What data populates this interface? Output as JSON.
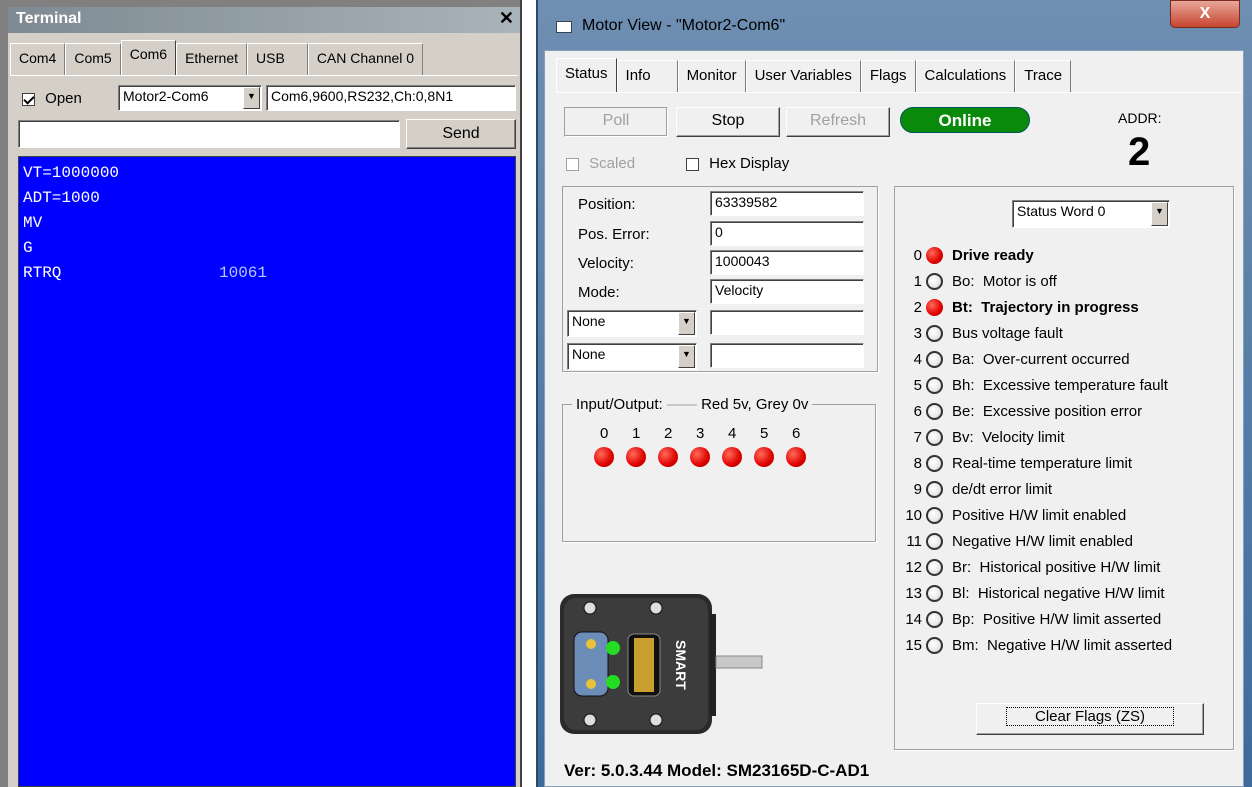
{
  "terminal": {
    "title": "Terminal",
    "close_glyph": "✕",
    "tabs": [
      "Com4",
      "Com5",
      "Com6",
      "Ethernet",
      "USB",
      "CAN Channel 0"
    ],
    "active_tab": "Com6",
    "open_label": "Open",
    "open_checked": true,
    "motor_select": "Motor2-Com6",
    "port_settings": "Com6,9600,RS232,Ch:0,8N1",
    "command_input": "",
    "send_label": "Send",
    "console_lines": [
      {
        "text": "VT=1000000",
        "value": ""
      },
      {
        "text": "ADT=1000",
        "value": ""
      },
      {
        "text": "MV",
        "value": ""
      },
      {
        "text": "G",
        "value": ""
      },
      {
        "text": "RTRQ",
        "value": "10061"
      }
    ]
  },
  "motor_view": {
    "title": "Motor View - \"Motor2-Com6\"",
    "close_glyph": "X",
    "tabs": [
      "Status",
      "Info",
      "Monitor",
      "User Variables",
      "Flags",
      "Calculations",
      "Trace"
    ],
    "active_tab": "Status",
    "buttons": {
      "poll": "Poll",
      "stop": "Stop",
      "refresh": "Refresh"
    },
    "online_label": "Online",
    "addr_label": "ADDR:",
    "addr_value": "2",
    "scaled_label": "Scaled",
    "hex_display_label": "Hex Display",
    "fields": [
      {
        "label": "Position:",
        "value": "63339582"
      },
      {
        "label": "Pos. Error:",
        "value": "0"
      },
      {
        "label": "Velocity:",
        "value": "1000043"
      },
      {
        "label": "Mode:",
        "value": "Velocity"
      }
    ],
    "extra_selects": [
      {
        "option": "None",
        "value": ""
      },
      {
        "option": "None",
        "value": ""
      }
    ],
    "io": {
      "title": "Input/Output:",
      "legend": "Red 5v, Grey 0v",
      "pins": [
        "0",
        "1",
        "2",
        "3",
        "4",
        "5",
        "6"
      ],
      "states": [
        "on",
        "on",
        "on",
        "on",
        "on",
        "on",
        "on"
      ]
    },
    "status_word_select": "Status Word 0",
    "status_bits": [
      {
        "idx": "0",
        "text": "Drive ready",
        "on": true,
        "bold": true
      },
      {
        "idx": "1",
        "text": "Bo:  Motor is off",
        "on": false,
        "bold": false
      },
      {
        "idx": "2",
        "text": "Bt:  Trajectory in progress",
        "on": true,
        "bold": true
      },
      {
        "idx": "3",
        "text": "Bus voltage fault",
        "on": false,
        "bold": false
      },
      {
        "idx": "4",
        "text": "Ba:  Over-current occurred",
        "on": false,
        "bold": false
      },
      {
        "idx": "5",
        "text": "Bh:  Excessive temperature fault",
        "on": false,
        "bold": false
      },
      {
        "idx": "6",
        "text": "Be:  Excessive position error",
        "on": false,
        "bold": false
      },
      {
        "idx": "7",
        "text": "Bv:  Velocity limit",
        "on": false,
        "bold": false
      },
      {
        "idx": "8",
        "text": "Real-time temperature limit",
        "on": false,
        "bold": false
      },
      {
        "idx": "9",
        "text": "de/dt error limit",
        "on": false,
        "bold": false
      },
      {
        "idx": "10",
        "text": "Positive H/W limit enabled",
        "on": false,
        "bold": false
      },
      {
        "idx": "11",
        "text": "Negative H/W limit enabled",
        "on": false,
        "bold": false
      },
      {
        "idx": "12",
        "text": "Br:  Historical positive H/W limit",
        "on": false,
        "bold": false
      },
      {
        "idx": "13",
        "text": "Bl:  Historical negative H/W limit",
        "on": false,
        "bold": false
      },
      {
        "idx": "14",
        "text": "Bp:  Positive H/W limit asserted",
        "on": false,
        "bold": false
      },
      {
        "idx": "15",
        "text": "Bm:  Negative H/W limit asserted",
        "on": false,
        "bold": false
      }
    ],
    "clear_flags_label": "Clear Flags (ZS)",
    "motor_brand": "SMART",
    "version_line": "Ver: 5.0.3.44  Model:  SM23165D-C-AD1"
  },
  "colors": {
    "console_bg": "#0000ff",
    "online_green": "#0a8a0a",
    "led_red": "#e00000"
  }
}
